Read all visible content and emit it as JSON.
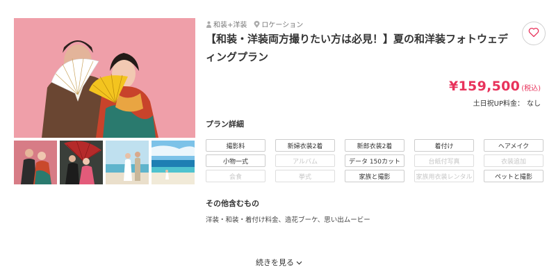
{
  "tags": [
    {
      "icon": "person-icon",
      "label": "和装+洋装"
    },
    {
      "icon": "location-pin-icon",
      "label": "ロケーション"
    }
  ],
  "title": "【和装・洋装両方撮りたい方は必見！】夏の和洋装フォトウェディングプラン",
  "price": {
    "amount": "¥159,500",
    "tax": "(税込)"
  },
  "holiday_fee": {
    "label": "土日祝UP料金：",
    "value": "なし"
  },
  "plan_details": {
    "heading": "プラン詳細",
    "items": [
      {
        "label": "撮影料",
        "included": true
      },
      {
        "label": "新婦衣装2着",
        "included": true
      },
      {
        "label": "新郎衣装2着",
        "included": true
      },
      {
        "label": "着付け",
        "included": true
      },
      {
        "label": "ヘアメイク",
        "included": true
      },
      {
        "label": "小物一式",
        "included": true
      },
      {
        "label": "アルバム",
        "included": false
      },
      {
        "label": "データ 150カット",
        "included": true
      },
      {
        "label": "台紙付写真",
        "included": false
      },
      {
        "label": "衣装追加",
        "included": false
      },
      {
        "label": "会食",
        "included": false
      },
      {
        "label": "挙式",
        "included": false
      },
      {
        "label": "家族と撮影",
        "included": true
      },
      {
        "label": "家族用衣装レンタル",
        "included": false
      },
      {
        "label": "ペットと撮影",
        "included": true
      }
    ]
  },
  "other_included": {
    "heading": "その他含むもの",
    "text": "洋装・和装・着付け料金、造花ブーケ、思い出ムービー"
  },
  "more_button": {
    "label": "続きを見る",
    "icon": "chevron-down-icon"
  },
  "favorite_button": {
    "icon": "heart-icon"
  },
  "colors": {
    "price": "#e8325b",
    "main_photo_bg": "#ef9fa9"
  }
}
